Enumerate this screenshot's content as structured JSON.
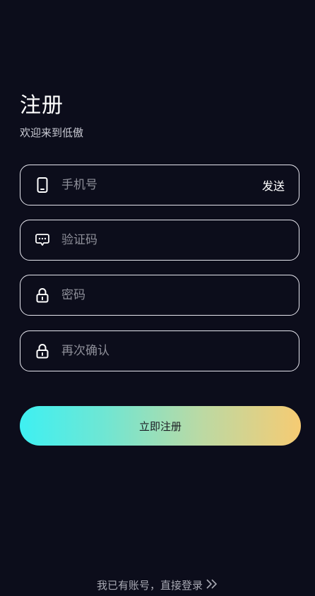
{
  "header": {
    "title": "注册",
    "subtitle": "欢迎来到低傲"
  },
  "form": {
    "phone": {
      "placeholder": "手机号",
      "value": "",
      "icon": "phone-icon"
    },
    "send_label": "发送",
    "code": {
      "placeholder": "验证码",
      "value": "",
      "icon": "message-icon"
    },
    "password": {
      "placeholder": "密码",
      "value": "",
      "icon": "lock-icon"
    },
    "confirm": {
      "placeholder": "再次确认",
      "value": "",
      "icon": "lock-icon"
    },
    "submit_label": "立即注册"
  },
  "footer": {
    "login_text": "我已有账号，直接登录",
    "icon": "double-chevron-right-icon"
  },
  "colors": {
    "background": "#0c0d1b",
    "gradient_start": "#3ef0f2",
    "gradient_end": "#f6cb73"
  }
}
